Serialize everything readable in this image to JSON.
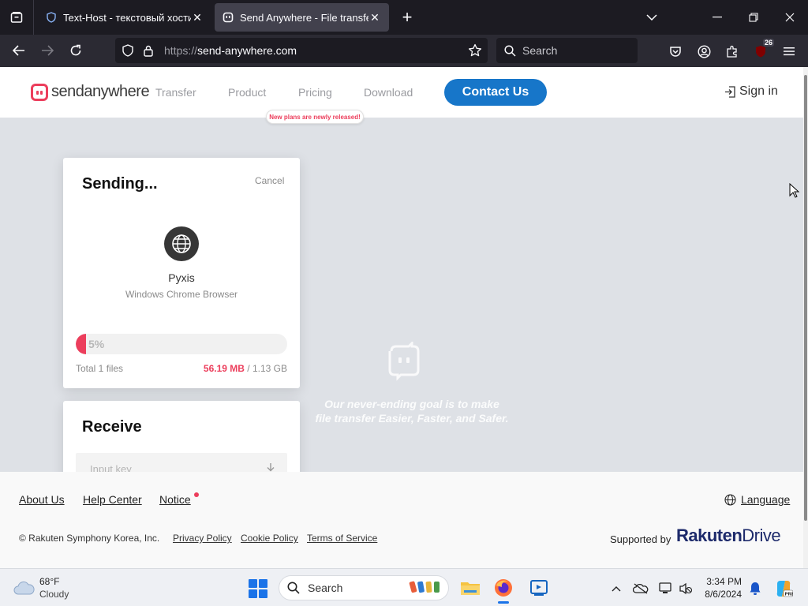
{
  "browser": {
    "tabs": [
      {
        "title": "Text-Host - текстовый хостинг",
        "active": false
      },
      {
        "title": "Send Anywhere - File transfer",
        "active": true
      }
    ],
    "url_scheme": "https://",
    "url_host": "send-anywhere.com",
    "search_placeholder": "Search",
    "extension_badge": "26"
  },
  "site": {
    "logo_text": "sendanywhere",
    "nav": {
      "transfer": "Transfer",
      "product": "Product",
      "pricing": "Pricing",
      "download": "Download"
    },
    "promo": "New plans are newly released!",
    "contact": "Contact Us",
    "signin": "Sign in",
    "hero": {
      "line1": "Our never-ending goal is to make",
      "line2": "file transfer Easier, Faster, and Safer."
    },
    "send_card": {
      "title": "Sending...",
      "cancel": "Cancel",
      "device_name": "Pyxis",
      "device_desc": "Windows Chrome Browser",
      "progress_label": "5%",
      "progress": 0.05,
      "total": "Total 1 files",
      "sent": "56.19 MB",
      "size_sep": " / ",
      "size_total": "1.13 GB"
    },
    "receive_card": {
      "title": "Receive",
      "input_placeholder": "Input key"
    },
    "footer": {
      "about": "About Us",
      "help": "Help Center",
      "notice": "Notice",
      "language": "Language",
      "copyright": "© Rakuten Symphony Korea, Inc.",
      "privacy": "Privacy Policy",
      "cookie": "Cookie Policy",
      "terms": "Terms of Service",
      "supported_by": "Supported by",
      "rakuten": "Rakuten",
      "drive": "Drive"
    }
  },
  "taskbar": {
    "temp": "68°F",
    "condition": "Cloudy",
    "search": "Search",
    "time": "3:34 PM",
    "date": "8/6/2024"
  },
  "colors": {
    "accent": "#ec3e5c",
    "contact_button": "#1776c9",
    "browser_dark": "#1c1b22"
  }
}
